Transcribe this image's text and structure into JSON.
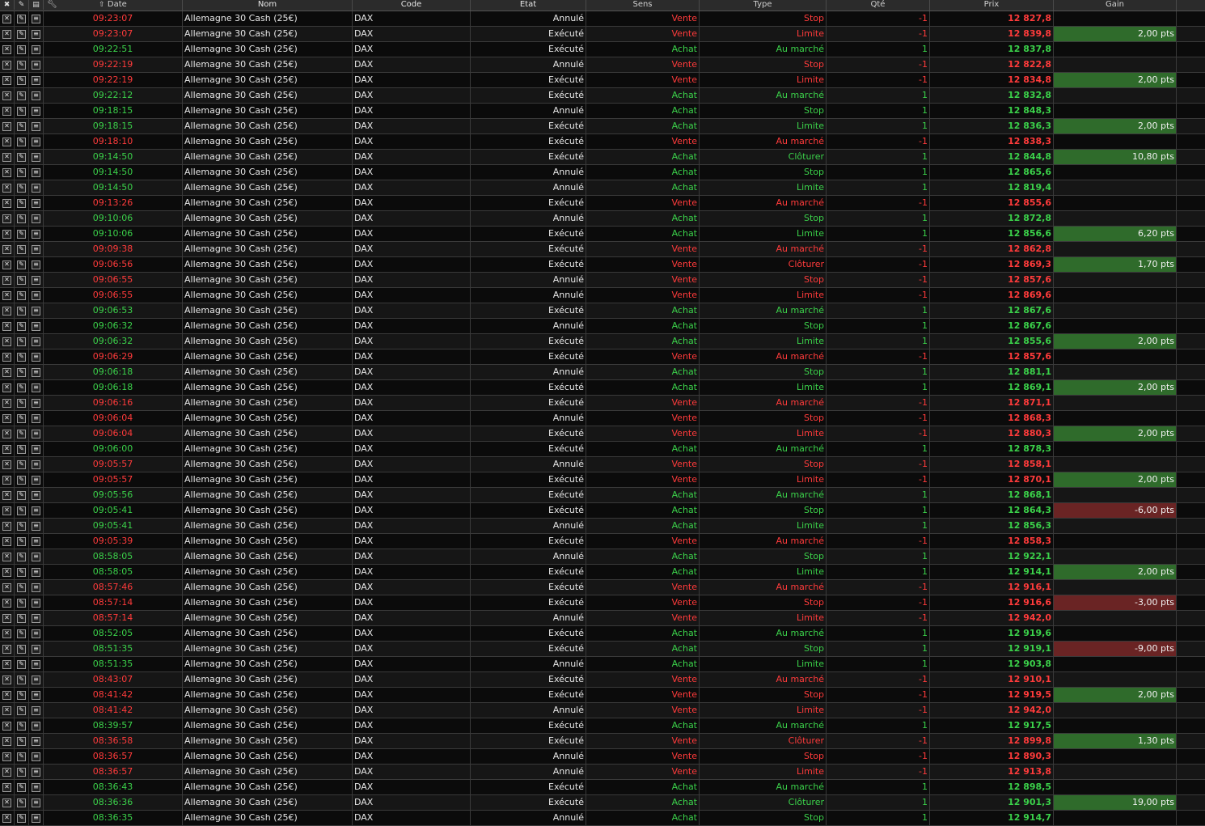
{
  "columns": {
    "date": "Date",
    "nom": "Nom",
    "code": "Code",
    "etat": "Etat",
    "sens": "Sens",
    "type": "Type",
    "qte": "Qté",
    "prix": "Prix",
    "gain": "Gain"
  },
  "colors": {
    "green": "#3bd14a",
    "red": "#ff3b3b",
    "gain_positive_bg": "#2f6b2b",
    "gain_negative_bg": "#6a2424"
  },
  "rows": [
    {
      "date": "09:23:07",
      "nom": "Allemagne 30 Cash (25€)",
      "code": "DAX",
      "etat": "Annulé",
      "sens": "Vente",
      "type": "Stop",
      "qte": "-1",
      "prix": "12 827,8",
      "gain": ""
    },
    {
      "date": "09:23:07",
      "nom": "Allemagne 30 Cash (25€)",
      "code": "DAX",
      "etat": "Exécuté",
      "sens": "Vente",
      "type": "Limite",
      "qte": "-1",
      "prix": "12 839,8",
      "gain": "2,00 pts"
    },
    {
      "date": "09:22:51",
      "nom": "Allemagne 30 Cash (25€)",
      "code": "DAX",
      "etat": "Exécuté",
      "sens": "Achat",
      "type": "Au marché",
      "qte": "1",
      "prix": "12 837,8",
      "gain": ""
    },
    {
      "date": "09:22:19",
      "nom": "Allemagne 30 Cash (25€)",
      "code": "DAX",
      "etat": "Annulé",
      "sens": "Vente",
      "type": "Stop",
      "qte": "-1",
      "prix": "12 822,8",
      "gain": ""
    },
    {
      "date": "09:22:19",
      "nom": "Allemagne 30 Cash (25€)",
      "code": "DAX",
      "etat": "Exécuté",
      "sens": "Vente",
      "type": "Limite",
      "qte": "-1",
      "prix": "12 834,8",
      "gain": "2,00 pts"
    },
    {
      "date": "09:22:12",
      "nom": "Allemagne 30 Cash (25€)",
      "code": "DAX",
      "etat": "Exécuté",
      "sens": "Achat",
      "type": "Au marché",
      "qte": "1",
      "prix": "12 832,8",
      "gain": ""
    },
    {
      "date": "09:18:15",
      "nom": "Allemagne 30 Cash (25€)",
      "code": "DAX",
      "etat": "Annulé",
      "sens": "Achat",
      "type": "Stop",
      "qte": "1",
      "prix": "12 848,3",
      "gain": ""
    },
    {
      "date": "09:18:15",
      "nom": "Allemagne 30 Cash (25€)",
      "code": "DAX",
      "etat": "Exécuté",
      "sens": "Achat",
      "type": "Limite",
      "qte": "1",
      "prix": "12 836,3",
      "gain": "2,00 pts"
    },
    {
      "date": "09:18:10",
      "nom": "Allemagne 30 Cash (25€)",
      "code": "DAX",
      "etat": "Exécuté",
      "sens": "Vente",
      "type": "Au marché",
      "qte": "-1",
      "prix": "12 838,3",
      "gain": ""
    },
    {
      "date": "09:14:50",
      "nom": "Allemagne 30 Cash (25€)",
      "code": "DAX",
      "etat": "Exécuté",
      "sens": "Achat",
      "type": "Clôturer",
      "qte": "1",
      "prix": "12 844,8",
      "gain": "10,80 pts"
    },
    {
      "date": "09:14:50",
      "nom": "Allemagne 30 Cash (25€)",
      "code": "DAX",
      "etat": "Annulé",
      "sens": "Achat",
      "type": "Stop",
      "qte": "1",
      "prix": "12 865,6",
      "gain": ""
    },
    {
      "date": "09:14:50",
      "nom": "Allemagne 30 Cash (25€)",
      "code": "DAX",
      "etat": "Annulé",
      "sens": "Achat",
      "type": "Limite",
      "qte": "1",
      "prix": "12 819,4",
      "gain": ""
    },
    {
      "date": "09:13:26",
      "nom": "Allemagne 30 Cash (25€)",
      "code": "DAX",
      "etat": "Exécuté",
      "sens": "Vente",
      "type": "Au marché",
      "qte": "-1",
      "prix": "12 855,6",
      "gain": ""
    },
    {
      "date": "09:10:06",
      "nom": "Allemagne 30 Cash (25€)",
      "code": "DAX",
      "etat": "Annulé",
      "sens": "Achat",
      "type": "Stop",
      "qte": "1",
      "prix": "12 872,8",
      "gain": ""
    },
    {
      "date": "09:10:06",
      "nom": "Allemagne 30 Cash (25€)",
      "code": "DAX",
      "etat": "Exécuté",
      "sens": "Achat",
      "type": "Limite",
      "qte": "1",
      "prix": "12 856,6",
      "gain": "6,20 pts"
    },
    {
      "date": "09:09:38",
      "nom": "Allemagne 30 Cash (25€)",
      "code": "DAX",
      "etat": "Exécuté",
      "sens": "Vente",
      "type": "Au marché",
      "qte": "-1",
      "prix": "12 862,8",
      "gain": ""
    },
    {
      "date": "09:06:56",
      "nom": "Allemagne 30 Cash (25€)",
      "code": "DAX",
      "etat": "Exécuté",
      "sens": "Vente",
      "type": "Clôturer",
      "qte": "-1",
      "prix": "12 869,3",
      "gain": "1,70 pts"
    },
    {
      "date": "09:06:55",
      "nom": "Allemagne 30 Cash (25€)",
      "code": "DAX",
      "etat": "Annulé",
      "sens": "Vente",
      "type": "Stop",
      "qte": "-1",
      "prix": "12 857,6",
      "gain": ""
    },
    {
      "date": "09:06:55",
      "nom": "Allemagne 30 Cash (25€)",
      "code": "DAX",
      "etat": "Annulé",
      "sens": "Vente",
      "type": "Limite",
      "qte": "-1",
      "prix": "12 869,6",
      "gain": ""
    },
    {
      "date": "09:06:53",
      "nom": "Allemagne 30 Cash (25€)",
      "code": "DAX",
      "etat": "Exécuté",
      "sens": "Achat",
      "type": "Au marché",
      "qte": "1",
      "prix": "12 867,6",
      "gain": ""
    },
    {
      "date": "09:06:32",
      "nom": "Allemagne 30 Cash (25€)",
      "code": "DAX",
      "etat": "Annulé",
      "sens": "Achat",
      "type": "Stop",
      "qte": "1",
      "prix": "12 867,6",
      "gain": ""
    },
    {
      "date": "09:06:32",
      "nom": "Allemagne 30 Cash (25€)",
      "code": "DAX",
      "etat": "Exécuté",
      "sens": "Achat",
      "type": "Limite",
      "qte": "1",
      "prix": "12 855,6",
      "gain": "2,00 pts"
    },
    {
      "date": "09:06:29",
      "nom": "Allemagne 30 Cash (25€)",
      "code": "DAX",
      "etat": "Exécuté",
      "sens": "Vente",
      "type": "Au marché",
      "qte": "-1",
      "prix": "12 857,6",
      "gain": ""
    },
    {
      "date": "09:06:18",
      "nom": "Allemagne 30 Cash (25€)",
      "code": "DAX",
      "etat": "Annulé",
      "sens": "Achat",
      "type": "Stop",
      "qte": "1",
      "prix": "12 881,1",
      "gain": ""
    },
    {
      "date": "09:06:18",
      "nom": "Allemagne 30 Cash (25€)",
      "code": "DAX",
      "etat": "Exécuté",
      "sens": "Achat",
      "type": "Limite",
      "qte": "1",
      "prix": "12 869,1",
      "gain": "2,00 pts"
    },
    {
      "date": "09:06:16",
      "nom": "Allemagne 30 Cash (25€)",
      "code": "DAX",
      "etat": "Exécuté",
      "sens": "Vente",
      "type": "Au marché",
      "qte": "-1",
      "prix": "12 871,1",
      "gain": ""
    },
    {
      "date": "09:06:04",
      "nom": "Allemagne 30 Cash (25€)",
      "code": "DAX",
      "etat": "Annulé",
      "sens": "Vente",
      "type": "Stop",
      "qte": "-1",
      "prix": "12 868,3",
      "gain": ""
    },
    {
      "date": "09:06:04",
      "nom": "Allemagne 30 Cash (25€)",
      "code": "DAX",
      "etat": "Exécuté",
      "sens": "Vente",
      "type": "Limite",
      "qte": "-1",
      "prix": "12 880,3",
      "gain": "2,00 pts"
    },
    {
      "date": "09:06:00",
      "nom": "Allemagne 30 Cash (25€)",
      "code": "DAX",
      "etat": "Exécuté",
      "sens": "Achat",
      "type": "Au marché",
      "qte": "1",
      "prix": "12 878,3",
      "gain": ""
    },
    {
      "date": "09:05:57",
      "nom": "Allemagne 30 Cash (25€)",
      "code": "DAX",
      "etat": "Annulé",
      "sens": "Vente",
      "type": "Stop",
      "qte": "-1",
      "prix": "12 858,1",
      "gain": ""
    },
    {
      "date": "09:05:57",
      "nom": "Allemagne 30 Cash (25€)",
      "code": "DAX",
      "etat": "Exécuté",
      "sens": "Vente",
      "type": "Limite",
      "qte": "-1",
      "prix": "12 870,1",
      "gain": "2,00 pts"
    },
    {
      "date": "09:05:56",
      "nom": "Allemagne 30 Cash (25€)",
      "code": "DAX",
      "etat": "Exécuté",
      "sens": "Achat",
      "type": "Au marché",
      "qte": "1",
      "prix": "12 868,1",
      "gain": ""
    },
    {
      "date": "09:05:41",
      "nom": "Allemagne 30 Cash (25€)",
      "code": "DAX",
      "etat": "Exécuté",
      "sens": "Achat",
      "type": "Stop",
      "qte": "1",
      "prix": "12 864,3",
      "gain": "-6,00 pts"
    },
    {
      "date": "09:05:41",
      "nom": "Allemagne 30 Cash (25€)",
      "code": "DAX",
      "etat": "Annulé",
      "sens": "Achat",
      "type": "Limite",
      "qte": "1",
      "prix": "12 856,3",
      "gain": ""
    },
    {
      "date": "09:05:39",
      "nom": "Allemagne 30 Cash (25€)",
      "code": "DAX",
      "etat": "Exécuté",
      "sens": "Vente",
      "type": "Au marché",
      "qte": "-1",
      "prix": "12 858,3",
      "gain": ""
    },
    {
      "date": "08:58:05",
      "nom": "Allemagne 30 Cash (25€)",
      "code": "DAX",
      "etat": "Annulé",
      "sens": "Achat",
      "type": "Stop",
      "qte": "1",
      "prix": "12 922,1",
      "gain": ""
    },
    {
      "date": "08:58:05",
      "nom": "Allemagne 30 Cash (25€)",
      "code": "DAX",
      "etat": "Exécuté",
      "sens": "Achat",
      "type": "Limite",
      "qte": "1",
      "prix": "12 914,1",
      "gain": "2,00 pts"
    },
    {
      "date": "08:57:46",
      "nom": "Allemagne 30 Cash (25€)",
      "code": "DAX",
      "etat": "Exécuté",
      "sens": "Vente",
      "type": "Au marché",
      "qte": "-1",
      "prix": "12 916,1",
      "gain": ""
    },
    {
      "date": "08:57:14",
      "nom": "Allemagne 30 Cash (25€)",
      "code": "DAX",
      "etat": "Exécuté",
      "sens": "Vente",
      "type": "Stop",
      "qte": "-1",
      "prix": "12 916,6",
      "gain": "-3,00 pts"
    },
    {
      "date": "08:57:14",
      "nom": "Allemagne 30 Cash (25€)",
      "code": "DAX",
      "etat": "Annulé",
      "sens": "Vente",
      "type": "Limite",
      "qte": "-1",
      "prix": "12 942,0",
      "gain": ""
    },
    {
      "date": "08:52:05",
      "nom": "Allemagne 30 Cash (25€)",
      "code": "DAX",
      "etat": "Exécuté",
      "sens": "Achat",
      "type": "Au marché",
      "qte": "1",
      "prix": "12 919,6",
      "gain": ""
    },
    {
      "date": "08:51:35",
      "nom": "Allemagne 30 Cash (25€)",
      "code": "DAX",
      "etat": "Exécuté",
      "sens": "Achat",
      "type": "Stop",
      "qte": "1",
      "prix": "12 919,1",
      "gain": "-9,00 pts"
    },
    {
      "date": "08:51:35",
      "nom": "Allemagne 30 Cash (25€)",
      "code": "DAX",
      "etat": "Annulé",
      "sens": "Achat",
      "type": "Limite",
      "qte": "1",
      "prix": "12 903,8",
      "gain": ""
    },
    {
      "date": "08:43:07",
      "nom": "Allemagne 30 Cash (25€)",
      "code": "DAX",
      "etat": "Exécuté",
      "sens": "Vente",
      "type": "Au marché",
      "qte": "-1",
      "prix": "12 910,1",
      "gain": ""
    },
    {
      "date": "08:41:42",
      "nom": "Allemagne 30 Cash (25€)",
      "code": "DAX",
      "etat": "Exécuté",
      "sens": "Vente",
      "type": "Stop",
      "qte": "-1",
      "prix": "12 919,5",
      "gain": "2,00 pts"
    },
    {
      "date": "08:41:42",
      "nom": "Allemagne 30 Cash (25€)",
      "code": "DAX",
      "etat": "Annulé",
      "sens": "Vente",
      "type": "Limite",
      "qte": "-1",
      "prix": "12 942,0",
      "gain": ""
    },
    {
      "date": "08:39:57",
      "nom": "Allemagne 30 Cash (25€)",
      "code": "DAX",
      "etat": "Exécuté",
      "sens": "Achat",
      "type": "Au marché",
      "qte": "1",
      "prix": "12 917,5",
      "gain": ""
    },
    {
      "date": "08:36:58",
      "nom": "Allemagne 30 Cash (25€)",
      "code": "DAX",
      "etat": "Exécuté",
      "sens": "Vente",
      "type": "Clôturer",
      "qte": "-1",
      "prix": "12 899,8",
      "gain": "1,30 pts"
    },
    {
      "date": "08:36:57",
      "nom": "Allemagne 30 Cash (25€)",
      "code": "DAX",
      "etat": "Annulé",
      "sens": "Vente",
      "type": "Stop",
      "qte": "-1",
      "prix": "12 890,3",
      "gain": ""
    },
    {
      "date": "08:36:57",
      "nom": "Allemagne 30 Cash (25€)",
      "code": "DAX",
      "etat": "Annulé",
      "sens": "Vente",
      "type": "Limite",
      "qte": "-1",
      "prix": "12 913,8",
      "gain": ""
    },
    {
      "date": "08:36:43",
      "nom": "Allemagne 30 Cash (25€)",
      "code": "DAX",
      "etat": "Exécuté",
      "sens": "Achat",
      "type": "Au marché",
      "qte": "1",
      "prix": "12 898,5",
      "gain": ""
    },
    {
      "date": "08:36:36",
      "nom": "Allemagne 30 Cash (25€)",
      "code": "DAX",
      "etat": "Exécuté",
      "sens": "Achat",
      "type": "Clôturer",
      "qte": "1",
      "prix": "12 901,3",
      "gain": "19,00 pts"
    },
    {
      "date": "08:36:35",
      "nom": "Allemagne 30 Cash (25€)",
      "code": "DAX",
      "etat": "Annulé",
      "sens": "Achat",
      "type": "Stop",
      "qte": "1",
      "prix": "12 914,7",
      "gain": ""
    }
  ]
}
